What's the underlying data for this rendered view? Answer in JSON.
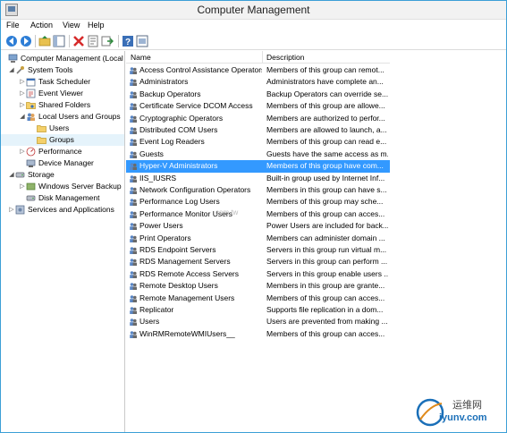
{
  "window": {
    "title": "Computer Management"
  },
  "menu": [
    "File",
    "Action",
    "View",
    "Help"
  ],
  "toolbar": [
    "back-icon",
    "forward-icon",
    "up-folder-icon",
    "show-hide-tree-icon",
    "delete-icon",
    "properties-icon",
    "export-icon",
    "help-icon",
    "console-icon"
  ],
  "tree": [
    {
      "label": "Computer Management (Local",
      "level": 0,
      "arrow": "",
      "icon": "computer-icon"
    },
    {
      "label": "System Tools",
      "level": 1,
      "arrow": "◢",
      "icon": "tools-icon"
    },
    {
      "label": "Task Scheduler",
      "level": 2,
      "arrow": "▷",
      "icon": "task-scheduler-icon"
    },
    {
      "label": "Event Viewer",
      "level": 2,
      "arrow": "▷",
      "icon": "event-viewer-icon"
    },
    {
      "label": "Shared Folders",
      "level": 2,
      "arrow": "▷",
      "icon": "shared-folders-icon"
    },
    {
      "label": "Local Users and Groups",
      "level": 2,
      "arrow": "◢",
      "icon": "users-groups-icon"
    },
    {
      "label": "Users",
      "level": 3,
      "arrow": "",
      "icon": "folder-icon"
    },
    {
      "label": "Groups",
      "level": 3,
      "arrow": "",
      "icon": "folder-icon",
      "selected": true
    },
    {
      "label": "Performance",
      "level": 2,
      "arrow": "▷",
      "icon": "performance-icon"
    },
    {
      "label": "Device Manager",
      "level": 2,
      "arrow": "",
      "icon": "device-manager-icon"
    },
    {
      "label": "Storage",
      "level": 1,
      "arrow": "◢",
      "icon": "storage-icon"
    },
    {
      "label": "Windows Server Backup",
      "level": 2,
      "arrow": "▷",
      "icon": "backup-icon"
    },
    {
      "label": "Disk Management",
      "level": 2,
      "arrow": "",
      "icon": "disk-icon"
    },
    {
      "label": "Services and Applications",
      "level": 1,
      "arrow": "▷",
      "icon": "services-icon"
    }
  ],
  "list": {
    "columns": {
      "name": "Name",
      "description": "Description"
    },
    "rows": [
      {
        "name": "Access Control Assistance Operators",
        "description": "Members of this group can remot..."
      },
      {
        "name": "Administrators",
        "description": "Administrators have complete an..."
      },
      {
        "name": "Backup Operators",
        "description": "Backup Operators can override se..."
      },
      {
        "name": "Certificate Service DCOM Access",
        "description": "Members of this group are allowe..."
      },
      {
        "name": "Cryptographic Operators",
        "description": "Members are authorized to perfor..."
      },
      {
        "name": "Distributed COM Users",
        "description": "Members are allowed to launch, a..."
      },
      {
        "name": "Event Log Readers",
        "description": "Members of this group can read e..."
      },
      {
        "name": "Guests",
        "description": "Guests have the same access as m..."
      },
      {
        "name": "Hyper-V Administrators",
        "description": "Members of this group have com...",
        "selected": true
      },
      {
        "name": "IIS_IUSRS",
        "description": "Built-in group used by Internet Inf..."
      },
      {
        "name": "Network Configuration Operators",
        "description": "Members in this group can have s..."
      },
      {
        "name": "Performance Log Users",
        "description": "Members of this group may sche..."
      },
      {
        "name": "Performance Monitor Users",
        "description": "Members of this group can acces..."
      },
      {
        "name": "Power Users",
        "description": "Power Users are included for back..."
      },
      {
        "name": "Print Operators",
        "description": "Members can administer domain ..."
      },
      {
        "name": "RDS Endpoint Servers",
        "description": "Servers in this group run virtual m..."
      },
      {
        "name": "RDS Management Servers",
        "description": "Servers in this group can perform ..."
      },
      {
        "name": "RDS Remote Access Servers",
        "description": "Servers in this group enable users ..."
      },
      {
        "name": "Remote Desktop Users",
        "description": "Members in this group are grante..."
      },
      {
        "name": "Remote Management Users",
        "description": "Members of this group can acces..."
      },
      {
        "name": "Replicator",
        "description": "Supports file replication in a dom..."
      },
      {
        "name": "Users",
        "description": "Users are prevented from making ..."
      },
      {
        "name": "WinRMRemoteWMIUsers__",
        "description": "Members of this group can acces..."
      }
    ]
  },
  "watermark": {
    "center": "com.tw",
    "brand": "运维网",
    "url": "iyunv.com"
  },
  "colors": {
    "selection": "#3399ff",
    "tree_selection": "#e5f3fb",
    "window_border": "#3c9fd6"
  }
}
